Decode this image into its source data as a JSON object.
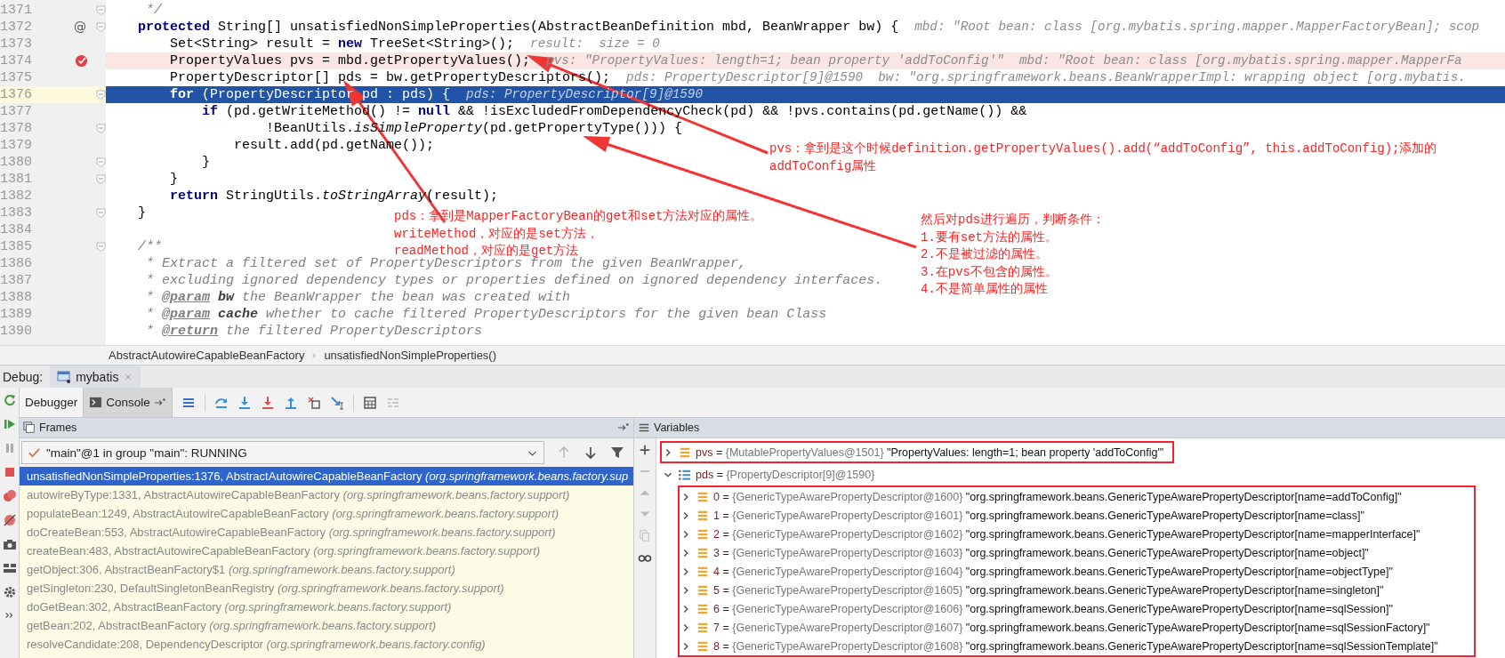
{
  "editor": {
    "lines": [
      {
        "number": "1371",
        "segments": [
          {
            "text": "     */",
            "kind": "comment"
          }
        ],
        "fold": true,
        "breakpoint": false,
        "selected": false
      },
      {
        "number": "1372",
        "segments": [
          {
            "text": "    protected",
            "kind": "kw"
          },
          {
            "text": " String[] unsatisfiedNonSimpleProperties(AbstractBeanDefinition mbd, BeanWrapper bw) {",
            "kind": "plain"
          }
        ],
        "hint": "mbd: \"Root bean: class [org.mybatis.spring.mapper.MapperFactoryBean]; scop",
        "gutter_text": "@",
        "fold": true,
        "breakpoint": false,
        "selected": false
      },
      {
        "number": "1373",
        "segments": [
          {
            "text": "        Set<String> result = ",
            "kind": "plain"
          },
          {
            "text": "new",
            "kind": "kw"
          },
          {
            "text": " TreeSet<String>();",
            "kind": "plain"
          }
        ],
        "hint": "result:  size = 0",
        "fold": false,
        "breakpoint": false,
        "selected": false
      },
      {
        "number": "1374",
        "segments": [
          {
            "text": "        PropertyValues pvs = mbd.getPropertyValues();",
            "kind": "plain"
          }
        ],
        "hint": "pvs: \"PropertyValues: length=1; bean property 'addToConfig'\"  mbd: \"Root bean: class [org.mybatis.spring.mapper.MapperFa",
        "fold": false,
        "breakpoint": true,
        "selected": false
      },
      {
        "number": "1375",
        "segments": [
          {
            "text": "        PropertyDescriptor[] pds = bw.getPropertyDescriptors();",
            "kind": "plain"
          }
        ],
        "hint": "pds: PropertyDescriptor[9]@1590  bw: \"org.springframework.beans.BeanWrapperImpl: wrapping object [org.mybatis.",
        "fold": false,
        "breakpoint": false,
        "selected": false
      },
      {
        "number": "1376",
        "segments": [
          {
            "text": "        for",
            "kind": "kw"
          },
          {
            "text": " (PropertyDescriptor pd : pds) {",
            "kind": "plain"
          }
        ],
        "hint": "pds: PropertyDescriptor[9]@1590",
        "fold": true,
        "breakpoint": false,
        "selected": true
      },
      {
        "number": "1377",
        "segments": [
          {
            "text": "            if",
            "kind": "kw"
          },
          {
            "text": " (pd.getWriteMethod() != ",
            "kind": "plain"
          },
          {
            "text": "null",
            "kind": "kw"
          },
          {
            "text": " && !isExcludedFromDependencyCheck(pd) && !pvs.contains(pd.getName()) &&",
            "kind": "plain"
          }
        ],
        "fold": false,
        "breakpoint": false,
        "selected": false
      },
      {
        "number": "1378",
        "segments": [
          {
            "text": "                    !BeanUtils.",
            "kind": "plain"
          },
          {
            "text": "isSimpleProperty",
            "kind": "static"
          },
          {
            "text": "(pd.getPropertyType())) {",
            "kind": "plain"
          }
        ],
        "fold": true,
        "breakpoint": false,
        "selected": false
      },
      {
        "number": "1379",
        "segments": [
          {
            "text": "                result.add(pd.getName());",
            "kind": "plain"
          }
        ],
        "fold": false,
        "breakpoint": false,
        "selected": false
      },
      {
        "number": "1380",
        "segments": [
          {
            "text": "            }",
            "kind": "plain"
          }
        ],
        "fold": true,
        "breakpoint": false,
        "selected": false
      },
      {
        "number": "1381",
        "segments": [
          {
            "text": "        }",
            "kind": "plain"
          }
        ],
        "fold": true,
        "breakpoint": false,
        "selected": false
      },
      {
        "number": "1382",
        "segments": [
          {
            "text": "        return",
            "kind": "kw"
          },
          {
            "text": " StringUtils.",
            "kind": "plain"
          },
          {
            "text": "toStringArray",
            "kind": "static"
          },
          {
            "text": "(result);",
            "kind": "plain"
          }
        ],
        "fold": false,
        "breakpoint": false,
        "selected": false
      },
      {
        "number": "1383",
        "segments": [
          {
            "text": "    }",
            "kind": "plain"
          }
        ],
        "fold": true,
        "breakpoint": false,
        "selected": false
      },
      {
        "number": "1384",
        "fold": false,
        "breakpoint": false,
        "selected": false
      },
      {
        "number": "1385",
        "segments": [
          {
            "text": "    /**",
            "kind": "comment"
          }
        ],
        "fold": true,
        "breakpoint": false,
        "selected": false
      },
      {
        "number": "1386",
        "segments": [
          {
            "text": "     * Extract a filtered set of PropertyDescriptors from the given BeanWrapper,",
            "kind": "comment"
          }
        ],
        "fold": false,
        "breakpoint": false,
        "selected": false
      },
      {
        "number": "1387",
        "segments": [
          {
            "text": "     * excluding ignored dependency types or properties defined on ignored dependency interfaces.",
            "kind": "comment"
          }
        ],
        "fold": false,
        "breakpoint": false,
        "selected": false
      },
      {
        "number": "1388",
        "segments": [
          {
            "text": "     * ",
            "kind": "comment"
          },
          {
            "text": "@param",
            "kind": "doctag"
          },
          {
            "text": " bw",
            "kind": "docparam"
          },
          {
            "text": " the BeanWrapper the bean was created with",
            "kind": "comment"
          }
        ],
        "fold": false,
        "breakpoint": false,
        "selected": false
      },
      {
        "number": "1389",
        "segments": [
          {
            "text": "     * ",
            "kind": "comment"
          },
          {
            "text": "@param",
            "kind": "doctag"
          },
          {
            "text": " cache",
            "kind": "docparam"
          },
          {
            "text": " whether to cache filtered PropertyDescriptors for the given bean Class",
            "kind": "comment"
          }
        ],
        "fold": false,
        "breakpoint": false,
        "selected": false
      },
      {
        "number": "1390",
        "segments": [
          {
            "text": "     * ",
            "kind": "comment"
          },
          {
            "text": "@return",
            "kind": "doctag"
          },
          {
            "text": " the filtered PropertyDescriptors",
            "kind": "comment"
          }
        ],
        "fold": false,
        "breakpoint": false,
        "selected": false
      }
    ]
  },
  "annotations": [
    {
      "lines": [
        "pvs：拿到是这个时候definition.getPropertyValues().add(“addToConfig”, this.addToConfig);添加的",
        "addToConfig属性"
      ]
    },
    {
      "lines": [
        "pds：拿到是MapperFactoryBean的get和set方法对应的属性。",
        "writeMethod，对应的是set方法，",
        "readMethod，对应的是get方法"
      ]
    },
    {
      "lines": [
        "然后对pds进行遍历，判断条件：",
        "1.要有set方法的属性。",
        "2.不是被过滤的属性。",
        "3.在pvs不包含的属性。",
        "4.不是简单属性的属性"
      ]
    }
  ],
  "breadcrumbs": [
    "AbstractAutowireCapableBeanFactory",
    "unsatisfiedNonSimpleProperties()"
  ],
  "debug": {
    "label": "Debug:",
    "session": "mybatis",
    "tabs": [
      {
        "label": "Debugger",
        "selected": true
      },
      {
        "label": "Console",
        "selected": false
      }
    ],
    "frames": {
      "title": "Frames",
      "thread": "\"main\"@1 in group \"main\": RUNNING",
      "items": [
        {
          "method": "unsatisfiedNonSimpleProperties:1376, AbstractAutowireCapableBeanFactory",
          "package": "(org.springframework.beans.factory.sup",
          "selected": true
        },
        {
          "method": "autowireByType:1331, AbstractAutowireCapableBeanFactory",
          "package": "(org.springframework.beans.factory.support)",
          "selected": false
        },
        {
          "method": "populateBean:1249, AbstractAutowireCapableBeanFactory",
          "package": "(org.springframework.beans.factory.support)",
          "selected": false
        },
        {
          "method": "doCreateBean:553, AbstractAutowireCapableBeanFactory",
          "package": "(org.springframework.beans.factory.support)",
          "selected": false
        },
        {
          "method": "createBean:483, AbstractAutowireCapableBeanFactory",
          "package": "(org.springframework.beans.factory.support)",
          "selected": false
        },
        {
          "method": "getObject:306, AbstractBeanFactory$1",
          "package": "(org.springframework.beans.factory.support)",
          "selected": false
        },
        {
          "method": "getSingleton:230, DefaultSingletonBeanRegistry",
          "package": "(org.springframework.beans.factory.support)",
          "selected": false
        },
        {
          "method": "doGetBean:302, AbstractBeanFactory",
          "package": "(org.springframework.beans.factory.support)",
          "selected": false
        },
        {
          "method": "getBean:202, AbstractBeanFactory",
          "package": "(org.springframework.beans.factory.support)",
          "selected": false
        },
        {
          "method": "resolveCandidate:208, DependencyDescriptor",
          "package": "(org.springframework.beans.factory.config)",
          "selected": false
        }
      ]
    },
    "variables": {
      "title": "Variables",
      "items": [
        {
          "name": "pvs",
          "operator": "=",
          "type": "{MutablePropertyValues@1501}",
          "value": "\"PropertyValues: length=1; bean property 'addToConfig'\"",
          "kind": "object",
          "expanded": false,
          "highlighted": true
        },
        {
          "name": "pds",
          "operator": "=",
          "type": "{PropertyDescriptor[9]@1590}",
          "kind": "array",
          "expanded": true,
          "highlighted": false,
          "children_highlighted": true,
          "children": [
            {
              "name": "0",
              "operator": "=",
              "type": "{GenericTypeAwarePropertyDescriptor@1600}",
              "value": "\"org.springframework.beans.GenericTypeAwarePropertyDescriptor[name=addToConfig]\"",
              "kind": "object",
              "expanded": false
            },
            {
              "name": "1",
              "operator": "=",
              "type": "{GenericTypeAwarePropertyDescriptor@1601}",
              "value": "\"org.springframework.beans.GenericTypeAwarePropertyDescriptor[name=class]\"",
              "kind": "object",
              "expanded": false
            },
            {
              "name": "2",
              "operator": "=",
              "type": "{GenericTypeAwarePropertyDescriptor@1602}",
              "value": "\"org.springframework.beans.GenericTypeAwarePropertyDescriptor[name=mapperInterface]\"",
              "kind": "object",
              "expanded": false
            },
            {
              "name": "3",
              "operator": "=",
              "type": "{GenericTypeAwarePropertyDescriptor@1603}",
              "value": "\"org.springframework.beans.GenericTypeAwarePropertyDescriptor[name=object]\"",
              "kind": "object",
              "expanded": false
            },
            {
              "name": "4",
              "operator": "=",
              "type": "{GenericTypeAwarePropertyDescriptor@1604}",
              "value": "\"org.springframework.beans.GenericTypeAwarePropertyDescriptor[name=objectType]\"",
              "kind": "object",
              "expanded": false
            },
            {
              "name": "5",
              "operator": "=",
              "type": "{GenericTypeAwarePropertyDescriptor@1605}",
              "value": "\"org.springframework.beans.GenericTypeAwarePropertyDescriptor[name=singleton]\"",
              "kind": "object",
              "expanded": false
            },
            {
              "name": "6",
              "operator": "=",
              "type": "{GenericTypeAwarePropertyDescriptor@1606}",
              "value": "\"org.springframework.beans.GenericTypeAwarePropertyDescriptor[name=sqlSession]\"",
              "kind": "object",
              "expanded": false
            },
            {
              "name": "7",
              "operator": "=",
              "type": "{GenericTypeAwarePropertyDescriptor@1607}",
              "value": "\"org.springframework.beans.GenericTypeAwarePropertyDescriptor[name=sqlSessionFactory]\"",
              "kind": "object",
              "expanded": false
            },
            {
              "name": "8",
              "operator": "=",
              "type": "{GenericTypeAwarePropertyDescriptor@1608}",
              "value": "\"org.springframework.beans.GenericTypeAwarePropertyDescriptor[name=sqlSessionTemplate]\"",
              "kind": "object",
              "expanded": false
            }
          ]
        }
      ]
    }
  }
}
